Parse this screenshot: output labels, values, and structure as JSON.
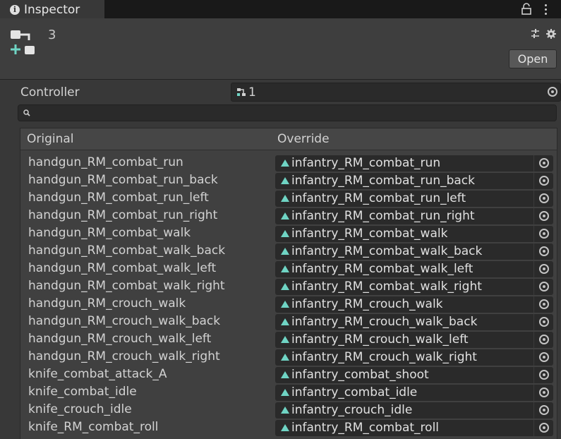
{
  "window": {
    "tab_label": "Inspector"
  },
  "header": {
    "asset_name": "3",
    "open_button": "Open"
  },
  "controller": {
    "label": "Controller",
    "value": "1"
  },
  "search": {
    "value": ""
  },
  "table": {
    "columns": [
      "Original",
      "Override"
    ],
    "rows": [
      {
        "original": "handgun_RM_combat_run",
        "override": "infantry_RM_combat_run"
      },
      {
        "original": "handgun_RM_combat_run_back",
        "override": "infantry_RM_combat_run_back"
      },
      {
        "original": "handgun_RM_combat_run_left",
        "override": "infantry_RM_combat_run_left"
      },
      {
        "original": "handgun_RM_combat_run_right",
        "override": "infantry_RM_combat_run_right"
      },
      {
        "original": "handgun_RM_combat_walk",
        "override": "infantry_RM_combat_walk"
      },
      {
        "original": "handgun_RM_combat_walk_back",
        "override": "infantry_RM_combat_walk_back"
      },
      {
        "original": "handgun_RM_combat_walk_left",
        "override": "infantry_RM_combat_walk_left"
      },
      {
        "original": "handgun_RM_combat_walk_right",
        "override": "infantry_RM_combat_walk_right"
      },
      {
        "original": "handgun_RM_crouch_walk",
        "override": "infantry_RM_crouch_walk"
      },
      {
        "original": "handgun_RM_crouch_walk_back",
        "override": "infantry_RM_crouch_walk_back"
      },
      {
        "original": "handgun_RM_crouch_walk_left",
        "override": "infantry_RM_crouch_walk_left"
      },
      {
        "original": "handgun_RM_crouch_walk_right",
        "override": "infantry_RM_crouch_walk_right"
      },
      {
        "original": "knife_combat_attack_A",
        "override": "infantry_combat_shoot"
      },
      {
        "original": "knife_combat_idle",
        "override": "infantry_combat_idle"
      },
      {
        "original": "knife_crouch_idle",
        "override": "infantry_crouch_idle"
      },
      {
        "original": "knife_RM_combat_roll",
        "override": "infantry_RM_combat_roll"
      }
    ]
  },
  "colors": {
    "accent_teal": "#6fd4c4",
    "panel_bg": "#383838",
    "field_bg": "#2a2a2a"
  },
  "icons": {
    "tab": "info-icon",
    "lock": "lock-icon",
    "menu": "kebab-menu-icon",
    "asset": "animator-override-controller-icon",
    "presets": "presets-icon",
    "settings": "gear-icon",
    "controller": "animator-controller-icon",
    "search": "search-icon",
    "clip": "animation-clip-icon",
    "picker": "object-picker-icon"
  }
}
